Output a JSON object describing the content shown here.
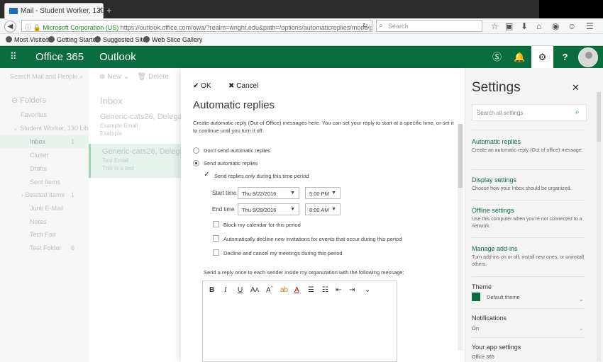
{
  "browser": {
    "tab_title": "Mail - Student Worker, 130...",
    "tab_close": "✕",
    "new_tab": "+",
    "url_security": "Microsoft Corporation (US)",
    "url": "https://outlook.office.com/owa/?realm=wright.edu&path=/options/automaticreplies/mode/popup",
    "search_placeholder": "Search",
    "bookmarks": [
      "Most Visited",
      "Getting Started",
      "Suggested Sites",
      "Web Slice Gallery"
    ]
  },
  "header": {
    "brand": "Office 365",
    "app_name": "Outlook",
    "brand_color": "#0a6d3e"
  },
  "left_nav": {
    "search": "Search Mail and People",
    "folders_label": "Folders",
    "favorites": "Favorites",
    "account": "Student Worker, 130 Lib...",
    "items": [
      {
        "label": "Inbox",
        "count": "1"
      },
      {
        "label": "Clutter",
        "count": ""
      },
      {
        "label": "Drafts",
        "count": ""
      },
      {
        "label": "Sent Items",
        "count": ""
      },
      {
        "label": "Deleted Items",
        "count": "1"
      },
      {
        "label": "Junk E-Mail",
        "count": ""
      },
      {
        "label": "Notes",
        "count": ""
      },
      {
        "label": "Tech Fair",
        "count": ""
      },
      {
        "label": "Test Folder",
        "count": "6"
      }
    ]
  },
  "mail_list": {
    "new_label": "New",
    "delete_label": "Delete",
    "title": "Inbox",
    "messages": [
      {
        "from": "Generic-cats26, Delegat...",
        "subject": "Example Email",
        "preview": "Example"
      },
      {
        "from": "Generic-cats26, Delegat...",
        "subject": "Test Email",
        "preview": "This is a test"
      }
    ]
  },
  "dialog": {
    "ok_label": "OK",
    "cancel_label": "Cancel",
    "title": "Automatic replies",
    "description": "Create automatic reply (Out of Office) messages here. You can set your reply to start at a specific time, or set it to continue until you turn it off.",
    "dont_send": "Don't send automatic replies",
    "send": "Send automatic replies",
    "time_period": "Send replies only during this time period",
    "start_time_label": "Start time",
    "start_date": "Thu 9/22/2016",
    "start_time": "5:00 PM",
    "end_time_label": "End time",
    "end_date": "Thu 9/29/2016",
    "end_time": "8:00 AM",
    "block_calendar": "Block my calendar for this period",
    "auto_decline": "Automatically decline new invitations for events that occur during this period",
    "decline_cancel": "Decline and cancel my meetings during this period",
    "reply_inside_label": "Send a reply once to each sender inside my organization with the following message:"
  },
  "settings": {
    "title": "Settings",
    "close": "✕",
    "search_placeholder": "Search all settings",
    "sections": [
      {
        "title": "Automatic replies",
        "desc": "Create an automatic reply (Out of office) message."
      },
      {
        "title": "Display settings",
        "desc": "Choose how your Inbox should be organized."
      },
      {
        "title": "Offline settings",
        "desc": "Use this computer when you're not connected to a network."
      },
      {
        "title": "Manage add-ins",
        "desc": "Turn add-ins on or off, install new ones, or uninstall others."
      }
    ],
    "theme_label": "Theme",
    "theme_value": "Default theme",
    "notifications_label": "Notifications",
    "notifications_value": "On",
    "app_settings_label": "Your app settings",
    "app_settings_sub": "Office 365"
  }
}
